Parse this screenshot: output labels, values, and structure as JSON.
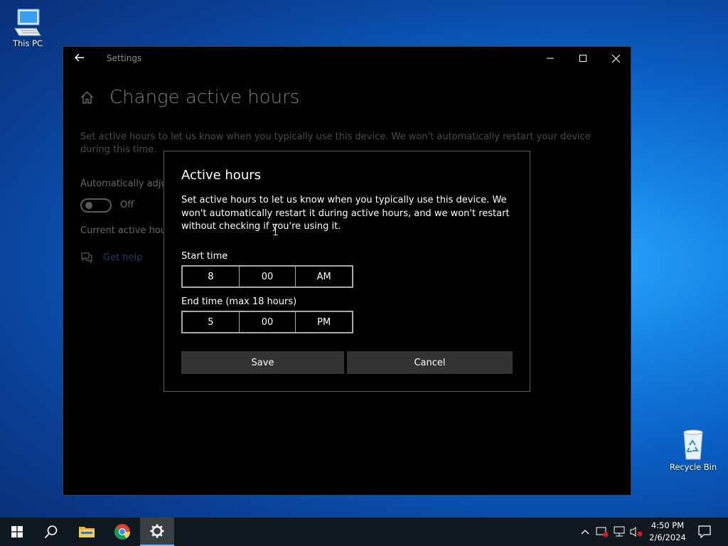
{
  "desktop": {
    "icons": [
      {
        "label": "This PC"
      },
      {
        "label": "Recycle Bin"
      }
    ]
  },
  "window": {
    "title": "Settings",
    "page_title": "Change active hours",
    "description": "Set active hours to let us know when you typically use this device. We won't automatically restart your device during this time.",
    "auto_adjust_label": "Automatically adjus",
    "toggle_state": "Off",
    "current_hours_label": "Current active hour",
    "get_help": "Get help"
  },
  "dialog": {
    "title": "Active hours",
    "body": "Set active hours to let us know when you typically use this device. We won't automatically restart it during active hours, and we won't restart without checking if you're using it.",
    "start_label": "Start time",
    "start": {
      "hour": "8",
      "minute": "00",
      "period": "AM"
    },
    "end_label": "End time (max 18 hours)",
    "end": {
      "hour": "5",
      "minute": "00",
      "period": "PM"
    },
    "save_label": "Save",
    "cancel_label": "Cancel"
  },
  "taskbar": {
    "time": "4:50 PM",
    "date": "2/6/2024"
  },
  "colors": {
    "accent": "#76b9ed",
    "window_bg": "#000000",
    "button_bg": "#333333"
  }
}
